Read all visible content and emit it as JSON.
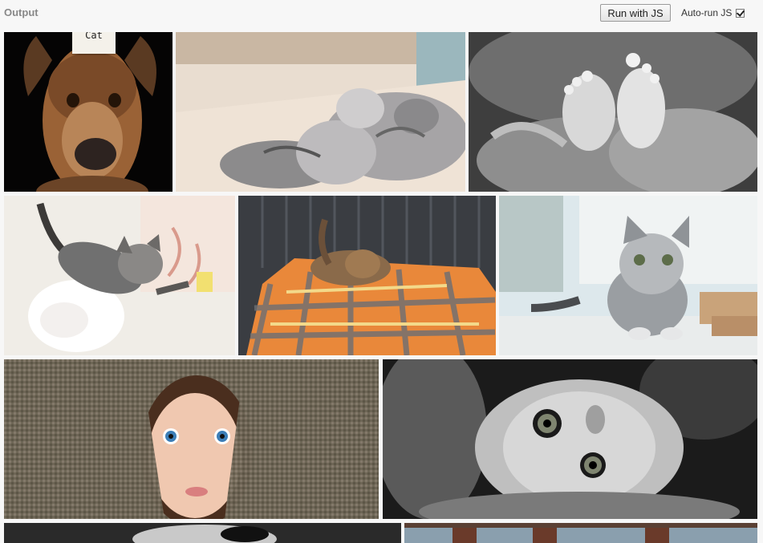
{
  "header": {
    "title": "Output",
    "run_button_label": "Run with JS",
    "autorun_label": "Auto-run JS",
    "autorun_checked": true
  },
  "gallery": {
    "tiles": [
      {
        "subject": "dog with note",
        "tag_text": "Cat"
      },
      {
        "subject": "two tabby kittens on floor"
      },
      {
        "subject": "baby feet in hands, black and white"
      },
      {
        "subject": "kitten leaping from white cat"
      },
      {
        "subject": "tabby cat on orange cushion"
      },
      {
        "subject": "silver tabby kitten by window"
      },
      {
        "subject": "child peeking from burlap"
      },
      {
        "subject": "grey kitten upside down, black and white"
      },
      {
        "subject": "bottom row image partially visible"
      },
      {
        "subject": "bottom row image partially visible"
      }
    ]
  },
  "colors": {
    "background": "#f7f7f7",
    "label_gray": "#888888"
  }
}
